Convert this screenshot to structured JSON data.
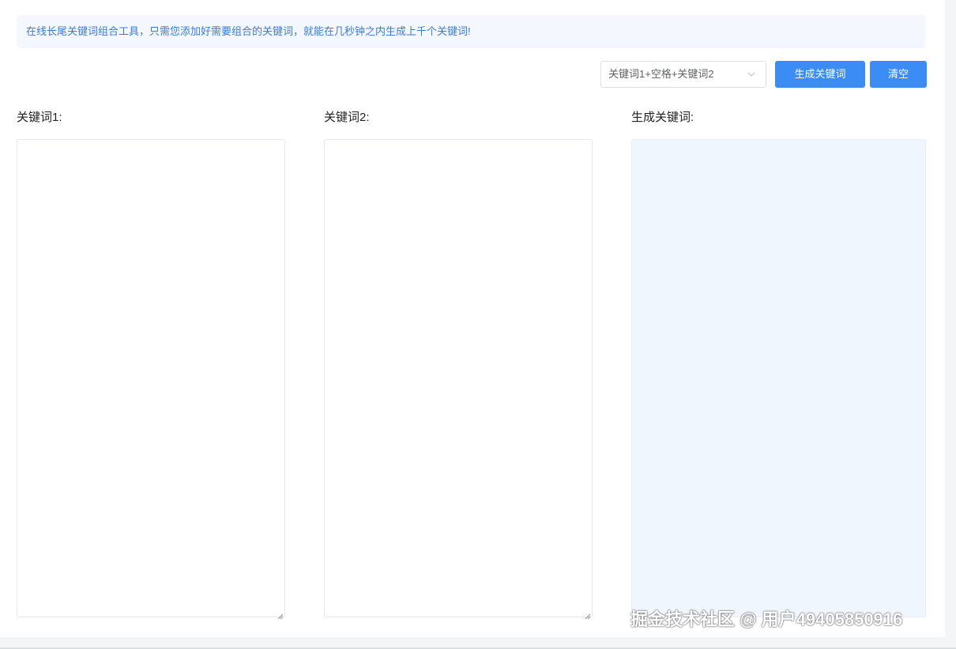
{
  "notice": {
    "text": "在线长尾关键词组合工具，只需您添加好需要组合的关键词，就能在几秒钟之内生成上千个关键词!"
  },
  "toolbar": {
    "combine_mode_selected": "关键词1+空格+关键词2",
    "generate_label": "生成关键词",
    "clear_label": "清空"
  },
  "columns": {
    "keyword1_label": "关键词1:",
    "keyword2_label": "关键词2:",
    "result_label": "生成关键词:",
    "keyword1_value": "",
    "keyword2_value": "",
    "result_value": ""
  },
  "watermark": {
    "text": "掘金技术社区 @ 用户49405850916"
  },
  "colors": {
    "accent": "#3c8cf5",
    "notice_text": "#3a7bd5",
    "notice_bg": "#f4f8fe",
    "result_bg": "#f0f6fe"
  },
  "icons": {
    "select_chevron": "chevron-down-icon",
    "resize_grip": "resize-grip-icon"
  }
}
